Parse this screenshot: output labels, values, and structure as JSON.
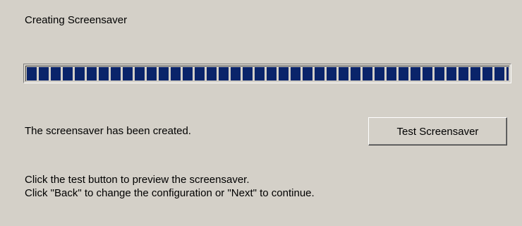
{
  "wizard": {
    "title": "Creating Screensaver",
    "progress": {
      "percent": 100
    },
    "status": "The screensaver has been created.",
    "test_button_label": "Test Screensaver",
    "instructions": [
      "Click the test button to preview the screensaver.",
      "Click \"Back\" to change the configuration or \"Next\" to continue."
    ]
  },
  "colors": {
    "background": "#d4d0c8",
    "progress_block": "#0a246a"
  }
}
